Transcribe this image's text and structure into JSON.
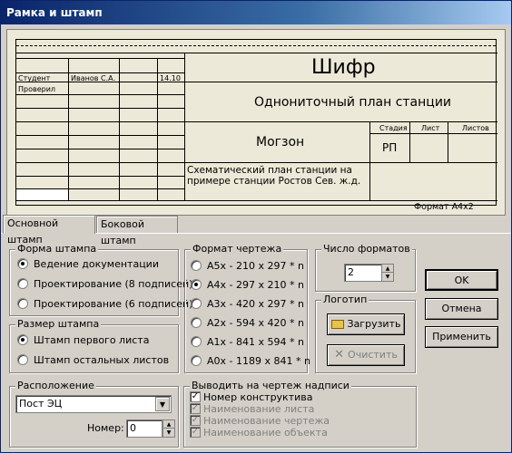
{
  "window": {
    "title": "Рамка и штамп"
  },
  "stamp": {
    "rows": [
      {
        "role": "Студент",
        "name": "Иванов С.А.",
        "date": "14.10"
      },
      {
        "role": "Проверил",
        "name": "",
        "date": ""
      }
    ],
    "code_label": "Шифр",
    "title": "Однониточный план станции",
    "organization": "Могзон",
    "col_stage": "Стадия",
    "col_sheet": "Лист",
    "col_sheets": "Листов",
    "stage_value": "РП",
    "drawing_name": "Схематический план станции на примере станции Ростов Сев. ж.д.",
    "format_label": "Формат А4х2"
  },
  "tabs": [
    {
      "label": "Основной штамп",
      "active": true
    },
    {
      "label": "Боковой штамп",
      "active": false
    }
  ],
  "stamp_form": {
    "title": "Форма штампа",
    "options": [
      {
        "label": "Ведение документации",
        "selected": true
      },
      {
        "label": "Проектирование (8 подписей)",
        "selected": false
      },
      {
        "label": "Проектирование (6 подписей)",
        "selected": false
      }
    ]
  },
  "stamp_size": {
    "title": "Размер штампа",
    "options": [
      {
        "label": "Штамп первого листа",
        "selected": true
      },
      {
        "label": "Штамп остальных листов",
        "selected": false
      }
    ]
  },
  "drawing_format": {
    "title": "Формат чертежа",
    "options": [
      {
        "label": "А5х -  210 х 297 * n",
        "selected": false
      },
      {
        "label": "А4х -  297 х 210 * n",
        "selected": true
      },
      {
        "label": "А3х -  420 х 297 * n",
        "selected": false
      },
      {
        "label": "А2х -  594 х 420 * n",
        "selected": false
      },
      {
        "label": "А1х -  841 х 594 * n",
        "selected": false
      },
      {
        "label": "А0х - 1189 х 841 * n",
        "selected": false
      }
    ]
  },
  "format_count": {
    "title": "Число форматов",
    "value": "2"
  },
  "logo": {
    "title": "Логотип",
    "load_label": "Загрузить",
    "clear_label": "Очистить"
  },
  "buttons": {
    "ok": "OK",
    "cancel": "Отмена",
    "apply": "Применить"
  },
  "location": {
    "title": "Расположение",
    "selected": "Пост ЭЦ",
    "number_label": "Номер:",
    "number_value": "0"
  },
  "output": {
    "title": "Выводить на чертеж надписи",
    "items": [
      {
        "label": "Номер конструктива",
        "checked": true,
        "enabled": true
      },
      {
        "label": "Наименование листа",
        "checked": true,
        "enabled": false
      },
      {
        "label": "Наименование чертежа",
        "checked": true,
        "enabled": false
      },
      {
        "label": "Наименование объекта",
        "checked": true,
        "enabled": false
      }
    ]
  }
}
